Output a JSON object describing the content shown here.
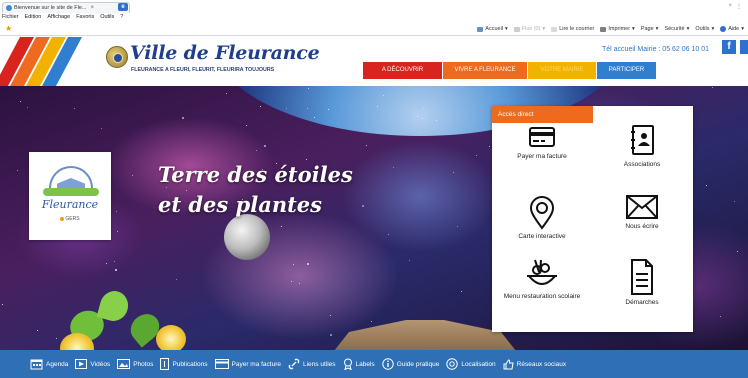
{
  "browser": {
    "tab_title": "Bienvenue sur le site de Fle...",
    "tab_close": "×",
    "new_tab": "e",
    "window_controls": [
      "×",
      "⋮"
    ],
    "menu": [
      "Fichier",
      "Edition",
      "Affichage",
      "Favoris",
      "Outils",
      "?"
    ],
    "toolbar": [
      "Accueil",
      "Flux (0)",
      "Lire le courrier",
      "Imprimer",
      "Page",
      "Sécurité",
      "Outils",
      "Aide"
    ]
  },
  "site": {
    "title": "Ville de Fleurance",
    "tagline": "FLEURANCE A FLEURI, FLEURIT, FLEURIRA TOUJOURS",
    "phone": "Tél accueil Mairie : 05 62 06 10 01",
    "social_fb": "f",
    "nav": [
      "A DÉCOUVRIR",
      "VIVRE A FLEURANCE",
      "VOTRE MAIRIE",
      "PARTICIPER"
    ],
    "colors": {
      "red": "#d8231f",
      "orange": "#ee6a1e",
      "yellow": "#f3b200",
      "blue": "#2f7ed0",
      "footer": "#2f6fb6"
    }
  },
  "hero": {
    "title_line1": "Terre des étoiles",
    "title_line2": "et des plantes",
    "logo_word": "Fleurance",
    "logo_sub": "GERS"
  },
  "access": {
    "heading": "Accès direct",
    "items": [
      {
        "label": "Payer ma facture",
        "icon": "card-icon"
      },
      {
        "label": "Associations",
        "icon": "contacts-icon"
      },
      {
        "label": "Carte interactive",
        "icon": "map-pin-icon"
      },
      {
        "label": "Nous écrire",
        "icon": "envelope-icon"
      },
      {
        "label": "Menu restauration scolaire",
        "icon": "meal-icon"
      },
      {
        "label": "Démarches",
        "icon": "document-icon"
      }
    ]
  },
  "bottom": {
    "items": [
      {
        "label": "Agenda",
        "icon": "calendar-icon"
      },
      {
        "label": "Vidéos",
        "icon": "video-icon"
      },
      {
        "label": "Photos",
        "icon": "photo-icon"
      },
      {
        "label": "Publications",
        "icon": "publication-icon"
      },
      {
        "label": "Payer ma facture",
        "icon": "card-icon"
      },
      {
        "label": "Liens utiles",
        "icon": "link-icon"
      },
      {
        "label": "Labels",
        "icon": "label-icon"
      },
      {
        "label": "Guide pratique",
        "icon": "info-icon"
      },
      {
        "label": "Localisation",
        "icon": "location-icon"
      },
      {
        "label": "Réseaux sociaux",
        "icon": "thumb-icon"
      }
    ]
  }
}
